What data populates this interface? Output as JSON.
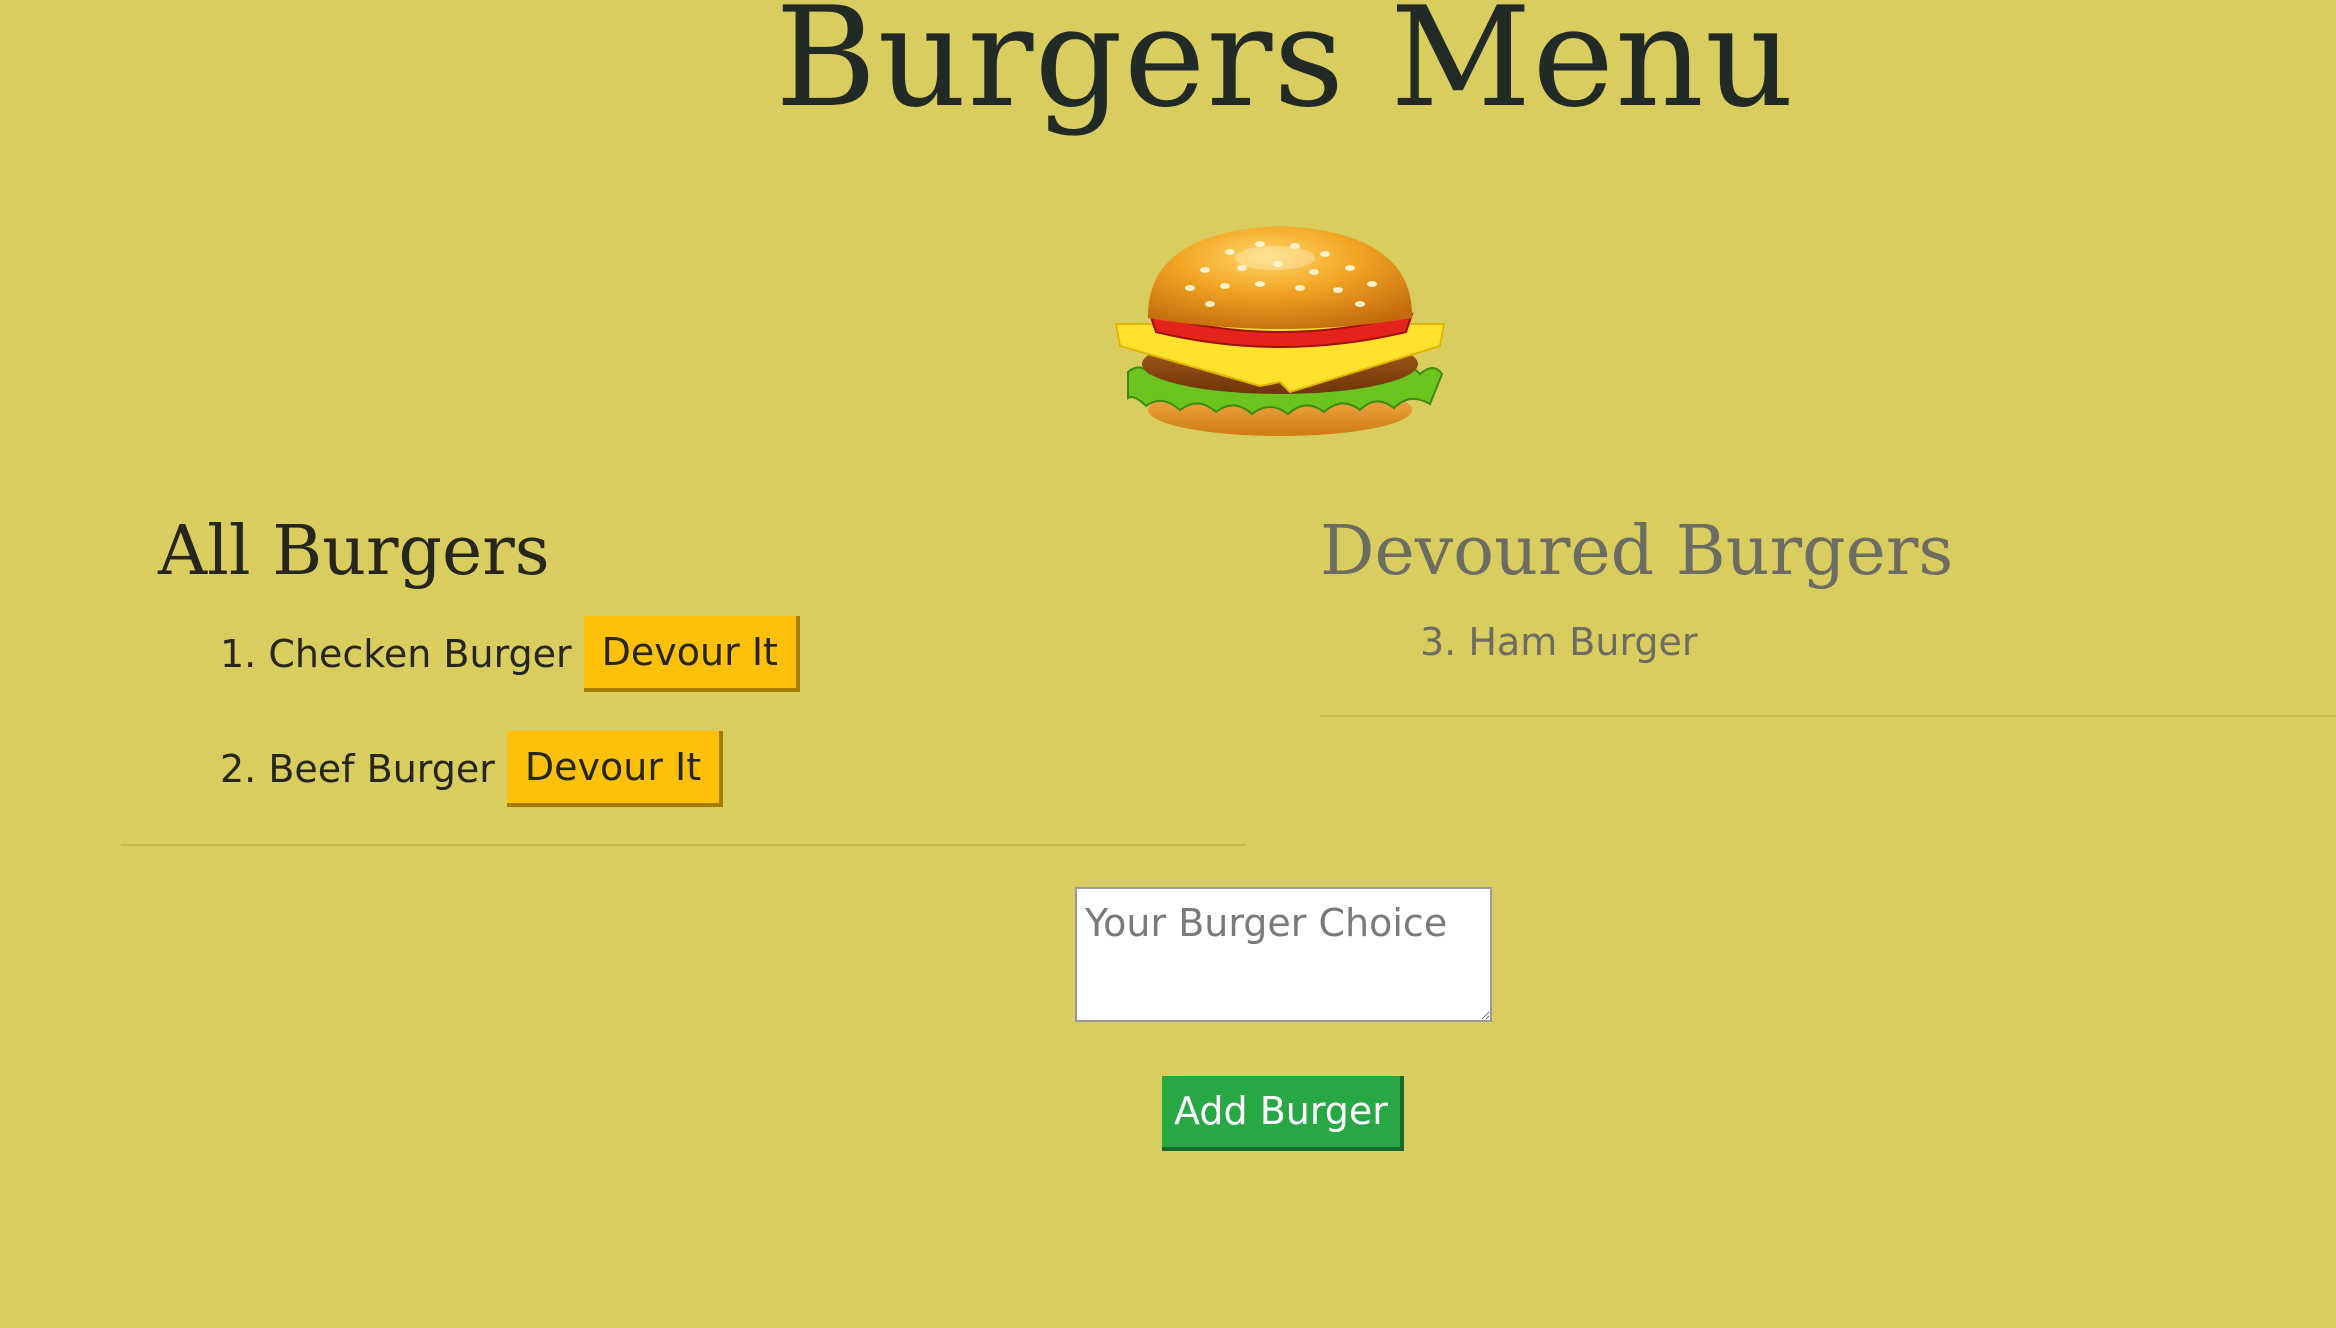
{
  "header": {
    "title": "Burgers Menu"
  },
  "hero": {
    "image_icon": "burger-icon"
  },
  "all_burgers": {
    "heading": "All Burgers",
    "items": [
      {
        "label": "1. Checken Burger",
        "button_label": "Devour It"
      },
      {
        "label": "2. Beef Burger",
        "button_label": "Devour It"
      }
    ]
  },
  "devoured_burgers": {
    "heading": "Devoured Burgers",
    "items": [
      {
        "label": "3. Ham Burger"
      }
    ]
  },
  "form": {
    "placeholder": "Your Burger Choice",
    "value": "",
    "submit_label": "Add Burger"
  },
  "colors": {
    "background": "#dacd60",
    "devour_button": "#ffc107",
    "add_button": "#28a745",
    "muted_text": "#6c6c62"
  }
}
